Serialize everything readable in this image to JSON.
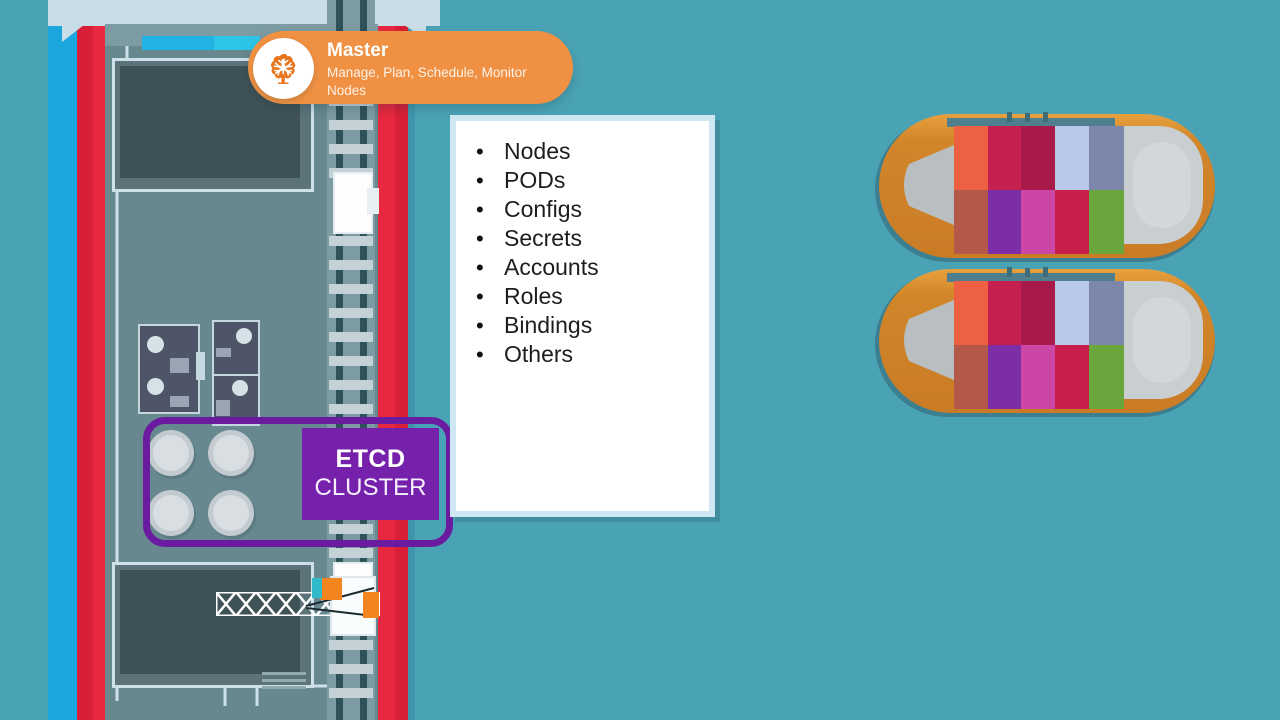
{
  "scene": {
    "title": "Kubernetes Master Node Port Illustration",
    "background_color": "#4aa3b5"
  },
  "badge": {
    "icon": "brain-icon",
    "title": "Master",
    "subtitle": "Manage, Plan, Schedule, Monitor Nodes",
    "background_color": "#ef9042",
    "text_color": "#ffffff"
  },
  "card": {
    "items": [
      {
        "bullet": "•",
        "label": "Nodes"
      },
      {
        "bullet": "•",
        "label": "PODs"
      },
      {
        "bullet": "•",
        "label": "Configs"
      },
      {
        "bullet": "•",
        "label": "Secrets"
      },
      {
        "bullet": "•",
        "label": "Accounts"
      },
      {
        "bullet": "•",
        "label": "Roles"
      },
      {
        "bullet": "•",
        "label": "Bindings"
      },
      {
        "bullet": "•",
        "label": "Others"
      }
    ],
    "background_color": "#ffffff",
    "border_color": "#cfe7f2"
  },
  "etcd": {
    "line1": "ETCD",
    "line2": "CLUSTER",
    "box_color": "#7621ab",
    "outline_color": "#6a1ba0",
    "text_color": "#ffffff"
  },
  "port": {
    "water_color": "#4aa3b5",
    "pier_color": "#67888f",
    "stripe_blue": "#1ba7dd",
    "stripe_red": "#d81f37",
    "top_band_color": "#c9dde6",
    "accent_cyan": "#21b3e4",
    "warehouse_color": "#5b7379",
    "warehouse_inner": "#3f5257",
    "block_color": "#4e5568",
    "tank_color": "#c3cbd0",
    "rail_color": "#2f5259",
    "tie_color": "#c4d2d7",
    "train_color": "#fdfdfd",
    "crane_color": "#ffffff",
    "container_orange": "#f2851e",
    "container_cyan": "#2fb9c9"
  },
  "ships": [
    {
      "name": "cargo-ship-top",
      "hull_color": "#d2862a",
      "deck_color": "#c3c8cb",
      "cargo_top_row": [
        "#ee6042",
        "#c5214f",
        "#a81a49",
        "#b8c9ea",
        "#7d87ab"
      ],
      "cargo_bottom_row": [
        "#b4594a",
        "#7b2ea6",
        "#cc46a5",
        "#c71e4c",
        "#6ba63c"
      ]
    },
    {
      "name": "cargo-ship-bottom",
      "hull_color": "#d2862a",
      "deck_color": "#c3c8cb",
      "cargo_top_row": [
        "#ee6042",
        "#c5214f",
        "#a81a49",
        "#b8c9ea",
        "#7d87ab"
      ],
      "cargo_bottom_row": [
        "#b4594a",
        "#7b2ea6",
        "#cc46a5",
        "#c71e4c",
        "#6ba63c"
      ]
    }
  ]
}
